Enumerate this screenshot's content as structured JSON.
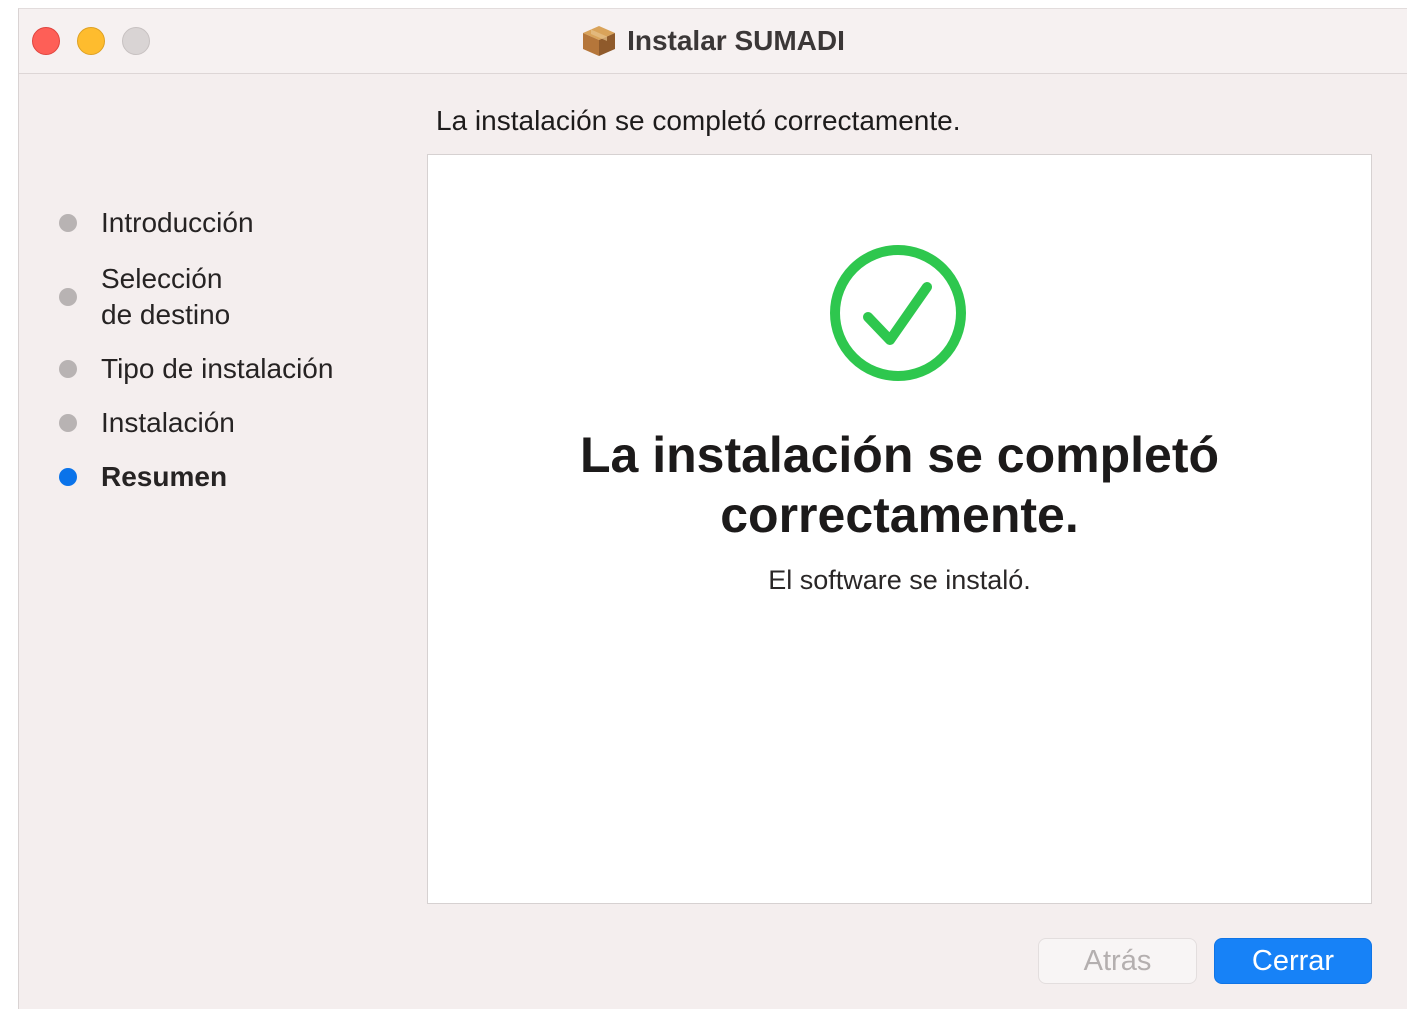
{
  "window": {
    "title": "Instalar SUMADI"
  },
  "header": {
    "text": "La instalación se completó correctamente."
  },
  "sidebar": {
    "steps": [
      {
        "label": "Introducción",
        "active": false
      },
      {
        "label": "Selección",
        "label_line2": "de destino",
        "active": false
      },
      {
        "label": "Tipo de instalación",
        "active": false
      },
      {
        "label": "Instalación",
        "active": false
      },
      {
        "label": "Resumen",
        "active": true
      }
    ]
  },
  "main": {
    "title_line1": "La instalación se completó",
    "title_line2": "correctamente.",
    "subtitle": "El software se instaló.",
    "icon": "checkmark-circle-icon"
  },
  "buttons": {
    "back_label": "Atrás",
    "close_label": "Cerrar"
  },
  "colors": {
    "accent": "#1782f7",
    "success": "#2ec74e",
    "active_step": "#0a73ea"
  }
}
